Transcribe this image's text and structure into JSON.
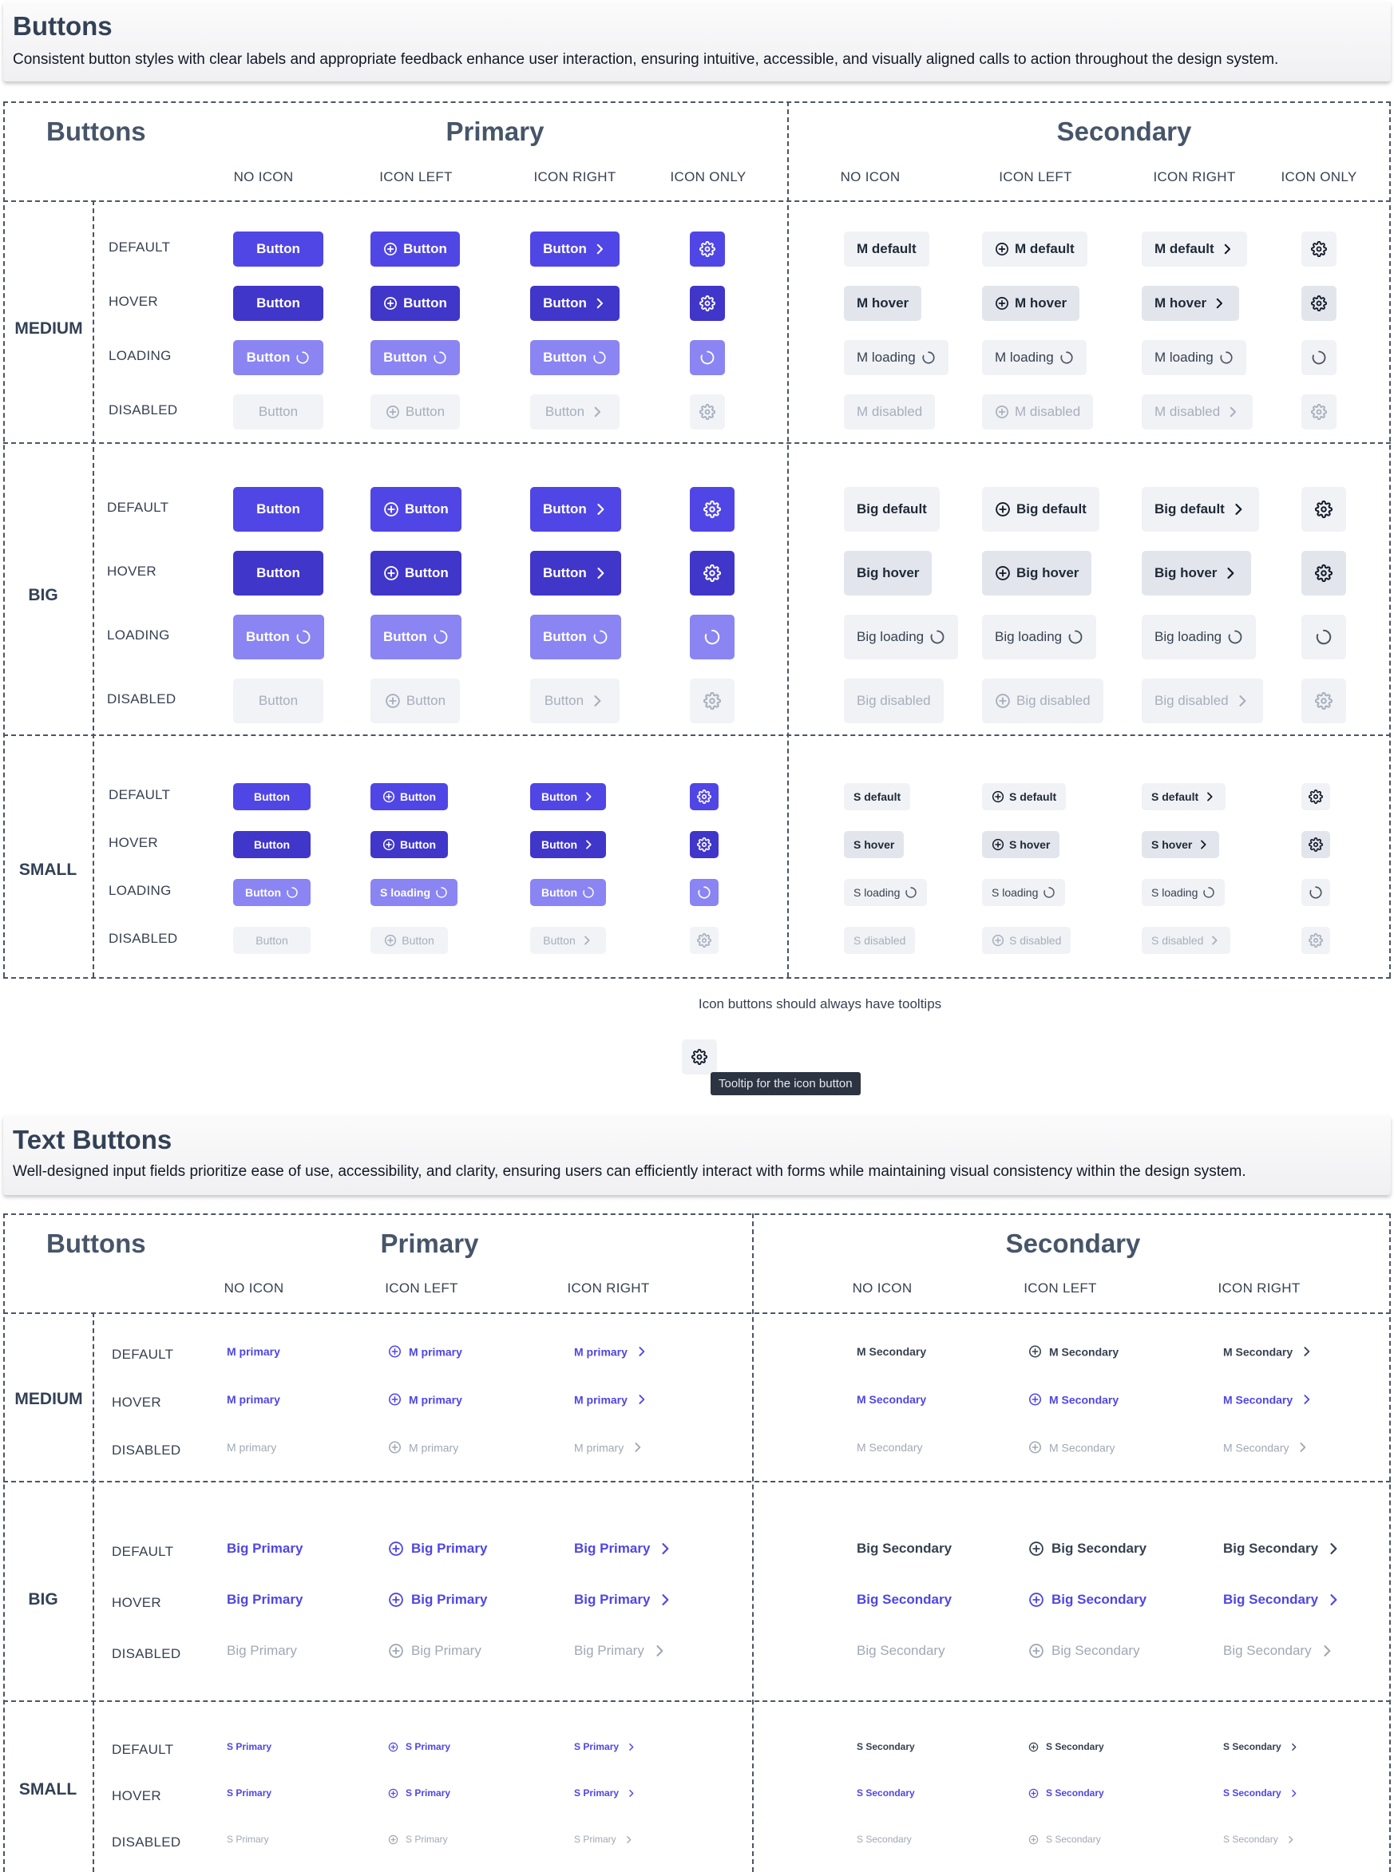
{
  "banner1": {
    "title": "Buttons",
    "description": "Consistent button styles with clear labels and appropriate feedback enhance user interaction, ensuring intuitive, accessible, and visually aligned calls to action throughout the design system."
  },
  "table1": {
    "corner": "Buttons",
    "primary_title": "Primary",
    "secondary_title": "Secondary",
    "columns": [
      "NO ICON",
      "ICON LEFT",
      "ICON RIGHT",
      "ICON ONLY"
    ],
    "states": [
      "DEFAULT",
      "HOVER",
      "LOADING",
      "DISABLED"
    ],
    "groups": [
      {
        "label": "MEDIUM",
        "primary_label": "Button",
        "secondary_labels": [
          "M default",
          "M hover",
          "M loading",
          "M disabled"
        ]
      },
      {
        "label": "BIG",
        "primary_label": "Button",
        "secondary_labels": [
          "Big default",
          "Big hover",
          "Big loading",
          "Big disabled"
        ]
      },
      {
        "label": "SMALL",
        "primary_label": "Button",
        "primary_loading_icon_left_label": "S loading",
        "secondary_labels": [
          "S default",
          "S hover",
          "S loading",
          "S disabled"
        ]
      }
    ]
  },
  "tooltip_demo": {
    "note": "Icon buttons should always have tooltips",
    "tooltip": "Tooltip for the icon button",
    "icon": "gear-icon"
  },
  "banner2": {
    "title": "Text Buttons",
    "description": "Well-designed input fields prioritize ease of use, accessibility, and clarity, ensuring users can efficiently interact with forms while maintaining visual consistency within the design system."
  },
  "table2": {
    "corner": "Buttons",
    "primary_title": "Primary",
    "secondary_title": "Secondary",
    "columns": [
      "NO ICON",
      "ICON LEFT",
      "ICON RIGHT"
    ],
    "states": [
      "DEFAULT",
      "HOVER",
      "DISABLED"
    ],
    "groups": [
      {
        "label": "MEDIUM",
        "primary_label": "M primary",
        "secondary_label": "M Secondary"
      },
      {
        "label": "BIG",
        "primary_label": "Big Primary",
        "secondary_label": "Big Secondary"
      },
      {
        "label": "SMALL",
        "primary_label": "S Primary",
        "secondary_label": "S Secondary"
      }
    ]
  },
  "icons": {
    "left": "plus-circle-icon",
    "right": "chevron-right-icon",
    "only": "gear-icon",
    "loading": "spinner-icon"
  },
  "colors": {
    "primary": "#5046e5",
    "primary_hover": "#4036c9",
    "primary_loading": "#8a85f2",
    "secondary_bg": "#f0f2f5",
    "disabled_text": "#a7afbc",
    "heading": "#475569"
  }
}
